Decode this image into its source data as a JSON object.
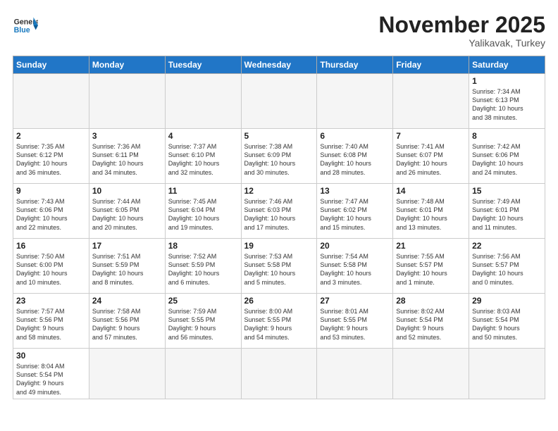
{
  "logo": {
    "text_general": "General",
    "text_blue": "Blue"
  },
  "title": "November 2025",
  "location": "Yalikavak, Turkey",
  "days_of_week": [
    "Sunday",
    "Monday",
    "Tuesday",
    "Wednesday",
    "Thursday",
    "Friday",
    "Saturday"
  ],
  "weeks": [
    [
      {
        "day": "",
        "info": ""
      },
      {
        "day": "",
        "info": ""
      },
      {
        "day": "",
        "info": ""
      },
      {
        "day": "",
        "info": ""
      },
      {
        "day": "",
        "info": ""
      },
      {
        "day": "",
        "info": ""
      },
      {
        "day": "1",
        "info": "Sunrise: 7:34 AM\nSunset: 6:13 PM\nDaylight: 10 hours\nand 38 minutes."
      }
    ],
    [
      {
        "day": "2",
        "info": "Sunrise: 7:35 AM\nSunset: 6:12 PM\nDaylight: 10 hours\nand 36 minutes."
      },
      {
        "day": "3",
        "info": "Sunrise: 7:36 AM\nSunset: 6:11 PM\nDaylight: 10 hours\nand 34 minutes."
      },
      {
        "day": "4",
        "info": "Sunrise: 7:37 AM\nSunset: 6:10 PM\nDaylight: 10 hours\nand 32 minutes."
      },
      {
        "day": "5",
        "info": "Sunrise: 7:38 AM\nSunset: 6:09 PM\nDaylight: 10 hours\nand 30 minutes."
      },
      {
        "day": "6",
        "info": "Sunrise: 7:40 AM\nSunset: 6:08 PM\nDaylight: 10 hours\nand 28 minutes."
      },
      {
        "day": "7",
        "info": "Sunrise: 7:41 AM\nSunset: 6:07 PM\nDaylight: 10 hours\nand 26 minutes."
      },
      {
        "day": "8",
        "info": "Sunrise: 7:42 AM\nSunset: 6:06 PM\nDaylight: 10 hours\nand 24 minutes."
      }
    ],
    [
      {
        "day": "9",
        "info": "Sunrise: 7:43 AM\nSunset: 6:06 PM\nDaylight: 10 hours\nand 22 minutes."
      },
      {
        "day": "10",
        "info": "Sunrise: 7:44 AM\nSunset: 6:05 PM\nDaylight: 10 hours\nand 20 minutes."
      },
      {
        "day": "11",
        "info": "Sunrise: 7:45 AM\nSunset: 6:04 PM\nDaylight: 10 hours\nand 19 minutes."
      },
      {
        "day": "12",
        "info": "Sunrise: 7:46 AM\nSunset: 6:03 PM\nDaylight: 10 hours\nand 17 minutes."
      },
      {
        "day": "13",
        "info": "Sunrise: 7:47 AM\nSunset: 6:02 PM\nDaylight: 10 hours\nand 15 minutes."
      },
      {
        "day": "14",
        "info": "Sunrise: 7:48 AM\nSunset: 6:01 PM\nDaylight: 10 hours\nand 13 minutes."
      },
      {
        "day": "15",
        "info": "Sunrise: 7:49 AM\nSunset: 6:01 PM\nDaylight: 10 hours\nand 11 minutes."
      }
    ],
    [
      {
        "day": "16",
        "info": "Sunrise: 7:50 AM\nSunset: 6:00 PM\nDaylight: 10 hours\nand 10 minutes."
      },
      {
        "day": "17",
        "info": "Sunrise: 7:51 AM\nSunset: 5:59 PM\nDaylight: 10 hours\nand 8 minutes."
      },
      {
        "day": "18",
        "info": "Sunrise: 7:52 AM\nSunset: 5:59 PM\nDaylight: 10 hours\nand 6 minutes."
      },
      {
        "day": "19",
        "info": "Sunrise: 7:53 AM\nSunset: 5:58 PM\nDaylight: 10 hours\nand 5 minutes."
      },
      {
        "day": "20",
        "info": "Sunrise: 7:54 AM\nSunset: 5:58 PM\nDaylight: 10 hours\nand 3 minutes."
      },
      {
        "day": "21",
        "info": "Sunrise: 7:55 AM\nSunset: 5:57 PM\nDaylight: 10 hours\nand 1 minute."
      },
      {
        "day": "22",
        "info": "Sunrise: 7:56 AM\nSunset: 5:57 PM\nDaylight: 10 hours\nand 0 minutes."
      }
    ],
    [
      {
        "day": "23",
        "info": "Sunrise: 7:57 AM\nSunset: 5:56 PM\nDaylight: 9 hours\nand 58 minutes."
      },
      {
        "day": "24",
        "info": "Sunrise: 7:58 AM\nSunset: 5:56 PM\nDaylight: 9 hours\nand 57 minutes."
      },
      {
        "day": "25",
        "info": "Sunrise: 7:59 AM\nSunset: 5:55 PM\nDaylight: 9 hours\nand 56 minutes."
      },
      {
        "day": "26",
        "info": "Sunrise: 8:00 AM\nSunset: 5:55 PM\nDaylight: 9 hours\nand 54 minutes."
      },
      {
        "day": "27",
        "info": "Sunrise: 8:01 AM\nSunset: 5:55 PM\nDaylight: 9 hours\nand 53 minutes."
      },
      {
        "day": "28",
        "info": "Sunrise: 8:02 AM\nSunset: 5:54 PM\nDaylight: 9 hours\nand 52 minutes."
      },
      {
        "day": "29",
        "info": "Sunrise: 8:03 AM\nSunset: 5:54 PM\nDaylight: 9 hours\nand 50 minutes."
      }
    ],
    [
      {
        "day": "30",
        "info": "Sunrise: 8:04 AM\nSunset: 5:54 PM\nDaylight: 9 hours\nand 49 minutes."
      },
      {
        "day": "",
        "info": ""
      },
      {
        "day": "",
        "info": ""
      },
      {
        "day": "",
        "info": ""
      },
      {
        "day": "",
        "info": ""
      },
      {
        "day": "",
        "info": ""
      },
      {
        "day": "",
        "info": ""
      }
    ]
  ]
}
